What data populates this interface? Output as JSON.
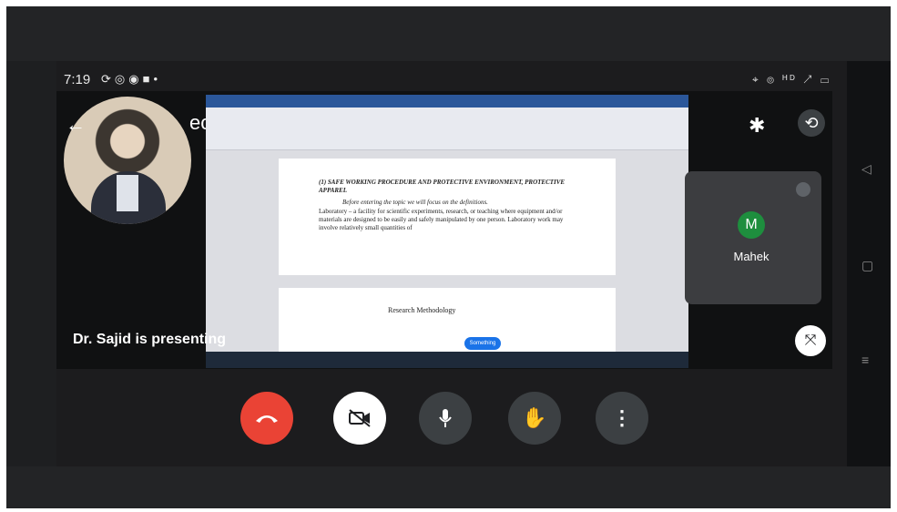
{
  "status_bar": {
    "time": "7:19",
    "left_icons": [
      "sync-icon",
      "instagram-icon",
      "whatsapp-icon",
      "facebook-icon",
      "dot-icon"
    ],
    "right_text": "⌖ ⦾ ᴴᴰ ↗ ▭",
    "battery": "▭"
  },
  "meeting": {
    "code": "ecbn-kvj",
    "presenting_label": "Dr. Sajid is presenting",
    "participant_tile": {
      "initial": "M",
      "name": "Mahek"
    }
  },
  "shared_document": {
    "heading": "(1) SAFE WORKING PROCEDURE AND PROTECTIVE ENVIRONMENT, PROTECTIVE APPAREL",
    "line1": "Before entering the topic we will focus on the definitions.",
    "body": "Laboratory – a facility for scientific experiments, research, or teaching where equipment and/or materials are designed to be easily and safely manipulated by one person. Laboratory work may involve relatively small quantities of",
    "section_title": "Research Methodology",
    "toast": "Something"
  },
  "controls": {
    "end_call": "end-call",
    "camera": "camera-off",
    "mic": "microphone",
    "hand": "raise-hand",
    "more": "more-options"
  },
  "colors": {
    "end_call": "#ea4335",
    "avatar": "#1e8e3e",
    "control_bg": "#3c4043"
  }
}
